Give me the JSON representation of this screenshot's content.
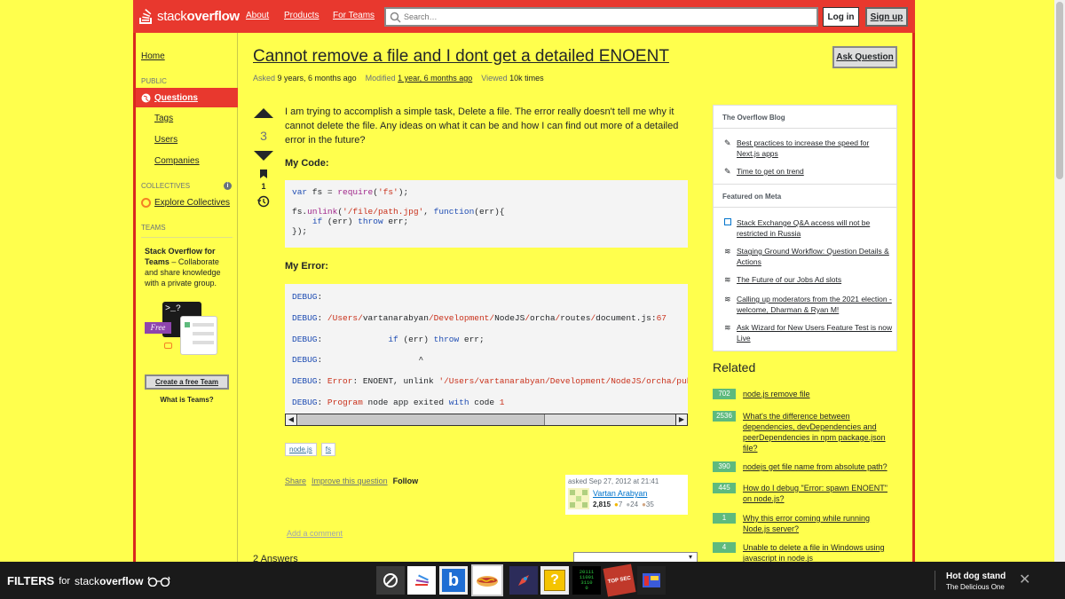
{
  "header": {
    "logo_prefix": "stack",
    "logo_suffix": "overflow",
    "nav": [
      "About",
      "Products",
      "For Teams"
    ],
    "search_placeholder": "Search…",
    "login": "Log in",
    "signup": "Sign up"
  },
  "sidebar": {
    "home": "Home",
    "public_head": "PUBLIC",
    "questions": "Questions",
    "tags": "Tags",
    "users": "Users",
    "companies": "Companies",
    "collectives_head": "COLLECTIVES",
    "explore": "Explore Collectives",
    "teams_head": "TEAMS",
    "teams_title": "Stack Overflow for Teams",
    "teams_desc": " – Collaborate and share knowledge with a private group.",
    "free_badge": "Free",
    "create_team": "Create a free Team",
    "what_is": "What is Teams?"
  },
  "question": {
    "title": "Cannot remove a file and I dont get a detailed ENOENT",
    "asked_label": "Asked",
    "asked_value": "9 years, 6 months ago",
    "modified_label": "Modified",
    "modified_value": "1 year, 6 months ago",
    "viewed_label": "Viewed",
    "viewed_value": "10k times",
    "ask_button": "Ask Question",
    "score": "3",
    "bookmarks": "1",
    "body": "I am trying to accomplish a simple task, Delete a file. The error really doesn't tell me why it cannot delete the file. Any ideas on what it can be and how I can find out more of a detailed error in the future?",
    "code_label": "My Code:",
    "error_label": "My Error:",
    "tags": [
      "node.js",
      "fs"
    ],
    "actions": [
      "Share",
      "Improve this question",
      "Follow"
    ],
    "asked_on": "asked Sep 27, 2012 at 21:41",
    "user_name": "Vartan Arabyan",
    "user_rep": "2,815",
    "gold": "7",
    "silver": "24",
    "bronze": "35",
    "add_comment": "Add a comment",
    "answers_partial": "2 Answers"
  },
  "blog": {
    "head1": "The Overflow Blog",
    "items1": [
      "Best practices to increase the speed for Next.js apps",
      "Time to get on trend"
    ],
    "head2": "Featured on Meta",
    "items2": [
      "Stack Exchange Q&A access will not be restricted in Russia",
      "Staging Ground Workflow: Question Details & Actions",
      "The Future of our Jobs Ad slots",
      "Calling up moderators from the 2021 election - welcome, Dharman & Ryan M!",
      "Ask Wizard for New Users Feature Test is now Live"
    ]
  },
  "related": {
    "title": "Related",
    "items": [
      {
        "count": "702",
        "text": "node.js remove file"
      },
      {
        "count": "2536",
        "text": "What's the difference between dependencies, devDependencies and peerDependencies in npm package.json file?"
      },
      {
        "count": "390",
        "text": "nodejs get file name from absolute path?"
      },
      {
        "count": "445",
        "text": "How do I debug \"Error: spawn ENOENT\" on node.js?"
      },
      {
        "count": "1",
        "text": "Why this error coming while running Node.js server?"
      },
      {
        "count": "4",
        "text": "Unable to delete a file in Windows using javascript in node.js"
      }
    ]
  },
  "bottombar": {
    "filters": "FILTERS",
    "for": "for",
    "brand_prefix": "stack",
    "brand_suffix": "overflow",
    "theme_title": "Hot dog stand",
    "theme_sub": "The Delicious One",
    "binary": "20111\n11001\n3110\n0",
    "top_label": "TOP SEC"
  },
  "colors": {
    "accent": "#e8382e",
    "background": "#ffff4d",
    "vote_green": "#5eba7d"
  }
}
